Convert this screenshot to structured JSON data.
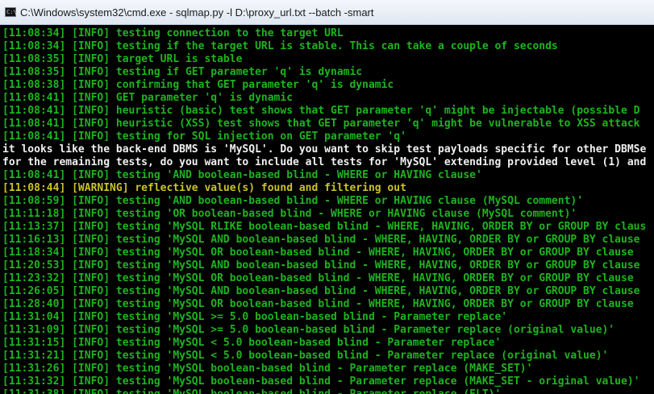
{
  "window": {
    "title": "C:\\Windows\\system32\\cmd.exe - sqlmap.py  -l D:\\proxy_url.txt --batch -smart",
    "app_icon": "cmd-icon",
    "icon_label": "C:\\"
  },
  "console": {
    "lines": [
      {
        "type": "info",
        "text": "[11:08:34] [INFO] testing connection to the target URL"
      },
      {
        "type": "info",
        "text": "[11:08:34] [INFO] testing if the target URL is stable. This can take a couple of seconds"
      },
      {
        "type": "info",
        "text": "[11:08:35] [INFO] target URL is stable"
      },
      {
        "type": "info",
        "text": "[11:08:35] [INFO] testing if GET parameter 'q' is dynamic"
      },
      {
        "type": "info",
        "text": "[11:08:38] [INFO] confirming that GET parameter 'q' is dynamic"
      },
      {
        "type": "info",
        "text": "[11:08:41] [INFO] GET parameter 'q' is dynamic"
      },
      {
        "type": "info",
        "text": "[11:08:41] [INFO] heuristic (basic) test shows that GET parameter 'q' might be injectable (possible D"
      },
      {
        "type": "info",
        "text": "[11:08:41] [INFO] heuristic (XSS) test shows that GET parameter 'q' might be vulnerable to XSS attack"
      },
      {
        "type": "info",
        "text": "[11:08:41] [INFO] testing for SQL injection on GET parameter 'q'"
      },
      {
        "type": "white",
        "text": "it looks like the back-end DBMS is 'MySQL'. Do you want to skip test payloads specific for other DBMSe"
      },
      {
        "type": "white",
        "text": "for the remaining tests, do you want to include all tests for 'MySQL' extending provided level (1) and"
      },
      {
        "type": "info",
        "text": "[11:08:41] [INFO] testing 'AND boolean-based blind - WHERE or HAVING clause'"
      },
      {
        "type": "warn",
        "text": "[11:08:44] [WARNING] reflective value(s) found and filtering out"
      },
      {
        "type": "info",
        "text": "[11:08:59] [INFO] testing 'AND boolean-based blind - WHERE or HAVING clause (MySQL comment)'"
      },
      {
        "type": "info",
        "text": "[11:11:18] [INFO] testing 'OR boolean-based blind - WHERE or HAVING clause (MySQL comment)'"
      },
      {
        "type": "info",
        "text": "[11:13:37] [INFO] testing 'MySQL RLIKE boolean-based blind - WHERE, HAVING, ORDER BY or GROUP BY claus"
      },
      {
        "type": "info",
        "text": "[11:16:13] [INFO] testing 'MySQL AND boolean-based blind - WHERE, HAVING, ORDER BY or GROUP BY clause"
      },
      {
        "type": "info",
        "text": "[11:18:34] [INFO] testing 'MySQL OR boolean-based blind - WHERE, HAVING, ORDER BY or GROUP BY clause"
      },
      {
        "type": "info",
        "text": "[11:20:53] [INFO] testing 'MySQL AND boolean-based blind - WHERE, HAVING, ORDER BY or GROUP BY clause"
      },
      {
        "type": "info",
        "text": "[11:23:32] [INFO] testing 'MySQL OR boolean-based blind - WHERE, HAVING, ORDER BY or GROUP BY clause"
      },
      {
        "type": "info",
        "text": "[11:26:05] [INFO] testing 'MySQL AND boolean-based blind - WHERE, HAVING, ORDER BY or GROUP BY clause"
      },
      {
        "type": "info",
        "text": "[11:28:40] [INFO] testing 'MySQL OR boolean-based blind - WHERE, HAVING, ORDER BY or GROUP BY clause"
      },
      {
        "type": "info",
        "text": "[11:31:04] [INFO] testing 'MySQL >= 5.0 boolean-based blind - Parameter replace'"
      },
      {
        "type": "info",
        "text": "[11:31:09] [INFO] testing 'MySQL >= 5.0 boolean-based blind - Parameter replace (original value)'"
      },
      {
        "type": "info",
        "text": "[11:31:15] [INFO] testing 'MySQL < 5.0 boolean-based blind - Parameter replace'"
      },
      {
        "type": "info",
        "text": "[11:31:21] [INFO] testing 'MySQL < 5.0 boolean-based blind - Parameter replace (original value)'"
      },
      {
        "type": "info",
        "text": "[11:31:26] [INFO] testing 'MySQL boolean-based blind - Parameter replace (MAKE_SET)'"
      },
      {
        "type": "info",
        "text": "[11:31:32] [INFO] testing 'MySQL boolean-based blind - Parameter replace (MAKE_SET - original value)'"
      },
      {
        "type": "info",
        "text": "[11:31:38] [INFO] testing 'MySQL boolean-based blind - Parameter replace (ELT)'"
      }
    ],
    "colors": {
      "background": "#000000",
      "info": "#1eb41e",
      "warning": "#c9c328",
      "prompt": "#f0f0f0"
    }
  }
}
